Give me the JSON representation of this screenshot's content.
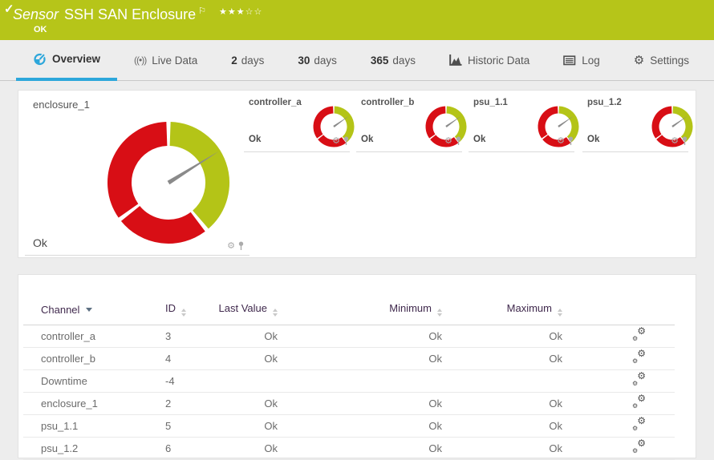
{
  "header": {
    "check_icon": "✓",
    "kind": "Sensor",
    "title": "SSH SAN Enclosure",
    "flag_icon": "⚐",
    "stars_filled": "★★★",
    "stars_empty": "☆☆",
    "status": "OK"
  },
  "icon_glyphs": {
    "live_data": "((•))",
    "gear": "⚙"
  },
  "tabs": [
    {
      "label": "Overview",
      "active": true
    },
    {
      "label": "Live Data"
    },
    {
      "num": "2",
      "label": "days"
    },
    {
      "num": "30",
      "label": "days"
    },
    {
      "num": "365",
      "label": "days"
    },
    {
      "label": "Historic Data"
    },
    {
      "label": "Log"
    },
    {
      "label": "Settings"
    }
  ],
  "gauge_style": {
    "green": "#b4c417",
    "red": "#d80e15",
    "needle": "#8a8a8a",
    "segments": [
      {
        "from": 2,
        "to": 139,
        "color": "green"
      },
      {
        "from": 143,
        "to": 231,
        "color": "red"
      },
      {
        "from": 235,
        "to": 358,
        "color": "red"
      }
    ]
  },
  "gauges": [
    {
      "name": "enclosure_1",
      "status": "Ok",
      "size": "large",
      "needle_angle": 58
    },
    {
      "name": "controller_a",
      "status": "Ok",
      "size": "small",
      "needle_angle": 55
    },
    {
      "name": "controller_b",
      "status": "Ok",
      "size": "small",
      "needle_angle": 55
    },
    {
      "name": "psu_1.1",
      "status": "Ok",
      "size": "small",
      "needle_angle": 55
    },
    {
      "name": "psu_1.2",
      "status": "Ok",
      "size": "small",
      "needle_angle": 55
    }
  ],
  "table": {
    "columns": [
      {
        "label": "Channel"
      },
      {
        "label": "ID"
      },
      {
        "label": "Last Value"
      },
      {
        "label": "Minimum"
      },
      {
        "label": "Maximum"
      }
    ],
    "rows": [
      {
        "channel": "controller_a",
        "id": "3",
        "last": "Ok",
        "min": "Ok",
        "max": "Ok"
      },
      {
        "channel": "controller_b",
        "id": "4",
        "last": "Ok",
        "min": "Ok",
        "max": "Ok"
      },
      {
        "channel": "Downtime",
        "id": "-4",
        "last": "",
        "min": "",
        "max": ""
      },
      {
        "channel": "enclosure_1",
        "id": "2",
        "last": "Ok",
        "min": "Ok",
        "max": "Ok"
      },
      {
        "channel": "psu_1.1",
        "id": "5",
        "last": "Ok",
        "min": "Ok",
        "max": "Ok"
      },
      {
        "channel": "psu_1.2",
        "id": "6",
        "last": "Ok",
        "min": "Ok",
        "max": "Ok"
      }
    ]
  },
  "colors": {
    "header_green": "#b6c519",
    "gauge_green": "#b4c417",
    "gauge_red": "#d80e15",
    "accent_blue": "#2da7db",
    "table_header_text": "#40294d"
  }
}
